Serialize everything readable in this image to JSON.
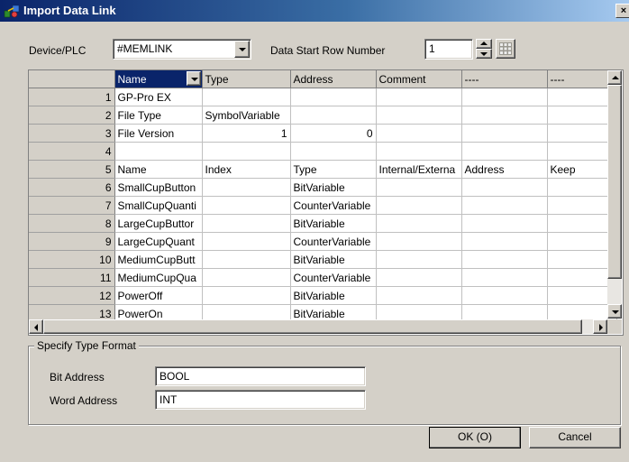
{
  "window": {
    "title": "Import Data Link",
    "close_label": "×"
  },
  "device": {
    "label": "Device/PLC",
    "value": "#MEMLINK"
  },
  "start_row": {
    "label": "Data Start Row Number",
    "value": "1"
  },
  "grid": {
    "columns": [
      "Name",
      "Type",
      "Address",
      "Comment",
      "----",
      "----"
    ],
    "rows": [
      {
        "num": "1",
        "cells": [
          "GP-Pro EX",
          "",
          "",
          "",
          "",
          ""
        ]
      },
      {
        "num": "2",
        "cells": [
          "File Type",
          "SymbolVariable",
          "",
          "",
          "",
          ""
        ]
      },
      {
        "num": "3",
        "cells": [
          "File Version",
          "1",
          "0",
          "",
          "",
          ""
        ]
      },
      {
        "num": "4",
        "cells": [
          "",
          "",
          "",
          "",
          "",
          ""
        ]
      },
      {
        "num": "5",
        "cells": [
          "Name",
          "Index",
          "Type",
          "Internal/Externa",
          "Address",
          "Keep"
        ]
      },
      {
        "num": "6",
        "cells": [
          "SmallCupButton",
          "",
          "BitVariable",
          "",
          "",
          ""
        ]
      },
      {
        "num": "7",
        "cells": [
          "SmallCupQuanti",
          "",
          "CounterVariable",
          "",
          "",
          ""
        ]
      },
      {
        "num": "8",
        "cells": [
          "LargeCupButtor",
          "",
          "BitVariable",
          "",
          "",
          ""
        ]
      },
      {
        "num": "9",
        "cells": [
          "LargeCupQuant",
          "",
          "CounterVariable",
          "",
          "",
          ""
        ]
      },
      {
        "num": "10",
        "cells": [
          "MediumCupButt",
          "",
          "BitVariable",
          "",
          "",
          ""
        ]
      },
      {
        "num": "11",
        "cells": [
          "MediumCupQua",
          "",
          "CounterVariable",
          "",
          "",
          ""
        ]
      },
      {
        "num": "12",
        "cells": [
          "PowerOff",
          "",
          "BitVariable",
          "",
          "",
          ""
        ]
      },
      {
        "num": "13",
        "cells": [
          "PowerOn",
          "",
          "BitVariable",
          "",
          "",
          ""
        ]
      }
    ]
  },
  "type_format": {
    "title": "Specify Type Format",
    "bit_label": "Bit Address",
    "bit_value": "BOOL",
    "word_label": "Word Address",
    "word_value": "INT"
  },
  "buttons": {
    "ok": "OK (O)",
    "cancel": "Cancel"
  }
}
